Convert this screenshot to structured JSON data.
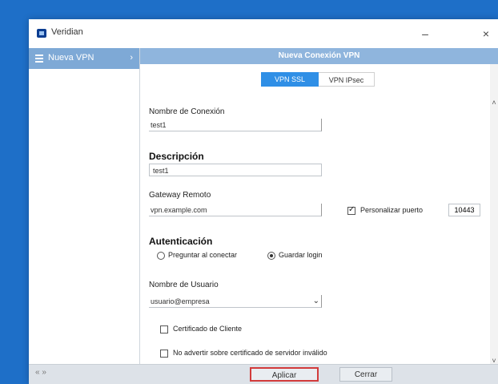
{
  "window": {
    "title": "Veridian"
  },
  "sidebar": {
    "items": [
      {
        "label": "Nueva VPN"
      }
    ]
  },
  "panel": {
    "header": "Nueva Conexión VPN"
  },
  "tabs": [
    {
      "label": "VPN SSL"
    },
    {
      "label": "VPN IPsec"
    }
  ],
  "form": {
    "connection_name": {
      "label": "Nombre de Conexión",
      "value": "test1"
    },
    "description": {
      "label": "Descripción",
      "value": "test1"
    },
    "remote_gateway": {
      "label": "Gateway Remoto",
      "value": "vpn.example.com"
    },
    "custom_port": {
      "label": "Personalizar puerto",
      "checked": true,
      "value": "10443"
    },
    "authentication": {
      "label": "Autenticación",
      "options": [
        {
          "label": "Preguntar al conectar",
          "selected": false
        },
        {
          "label": "Guardar login",
          "selected": true
        }
      ]
    },
    "username": {
      "label": "Nombre de Usuario",
      "value": "usuario@empresa"
    },
    "client_cert": {
      "label": "Certificado de Cliente",
      "checked": false
    },
    "invalid_cert_warning": {
      "label": "No advertir sobre certificado de servidor inválido",
      "checked": false
    }
  },
  "footer": {
    "status": "« »",
    "apply_label": "Aplicar",
    "cancel_label": "Cerrar"
  },
  "icons": [
    "app-icon",
    "menu-icon",
    "chevron-right-icon",
    "minimize-icon",
    "close-icon",
    "scroll-up-icon",
    "scroll-down-icon",
    "dropdown-chevron-icon"
  ]
}
